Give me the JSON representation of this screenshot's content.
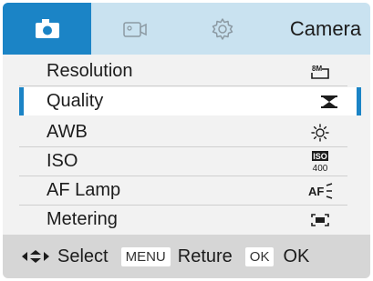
{
  "header": {
    "tabs": [
      {
        "icon": "camera-icon",
        "active": true
      },
      {
        "icon": "video-icon",
        "active": false
      },
      {
        "icon": "gear-icon",
        "active": false
      }
    ],
    "title": "Camera"
  },
  "menu": {
    "items": [
      {
        "label": "Resolution",
        "value_icon": "8M",
        "selected": false
      },
      {
        "label": "Quality",
        "value_icon": "quality-fine-icon",
        "selected": true
      },
      {
        "label": "AWB",
        "value_icon": "sun-icon",
        "selected": false
      },
      {
        "label": "ISO",
        "value_icon": "ISO 400",
        "iso_top": "ISO",
        "iso_bottom": "400",
        "selected": false
      },
      {
        "label": "AF Lamp",
        "value_icon": "AF lamp",
        "af_text": "AF",
        "selected": false
      },
      {
        "label": "Metering",
        "value_icon": "metering-icon",
        "selected": false
      }
    ]
  },
  "footer": {
    "select_label": "Select",
    "menu_key": "MENU",
    "return_label": "Reture",
    "ok_key": "OK",
    "ok_label": "OK"
  },
  "colors": {
    "accent": "#1b84c6",
    "tabbar_bg": "#c9e2f0",
    "menu_bg": "#f2f2f2",
    "footer_bg": "#d6d6d6"
  }
}
